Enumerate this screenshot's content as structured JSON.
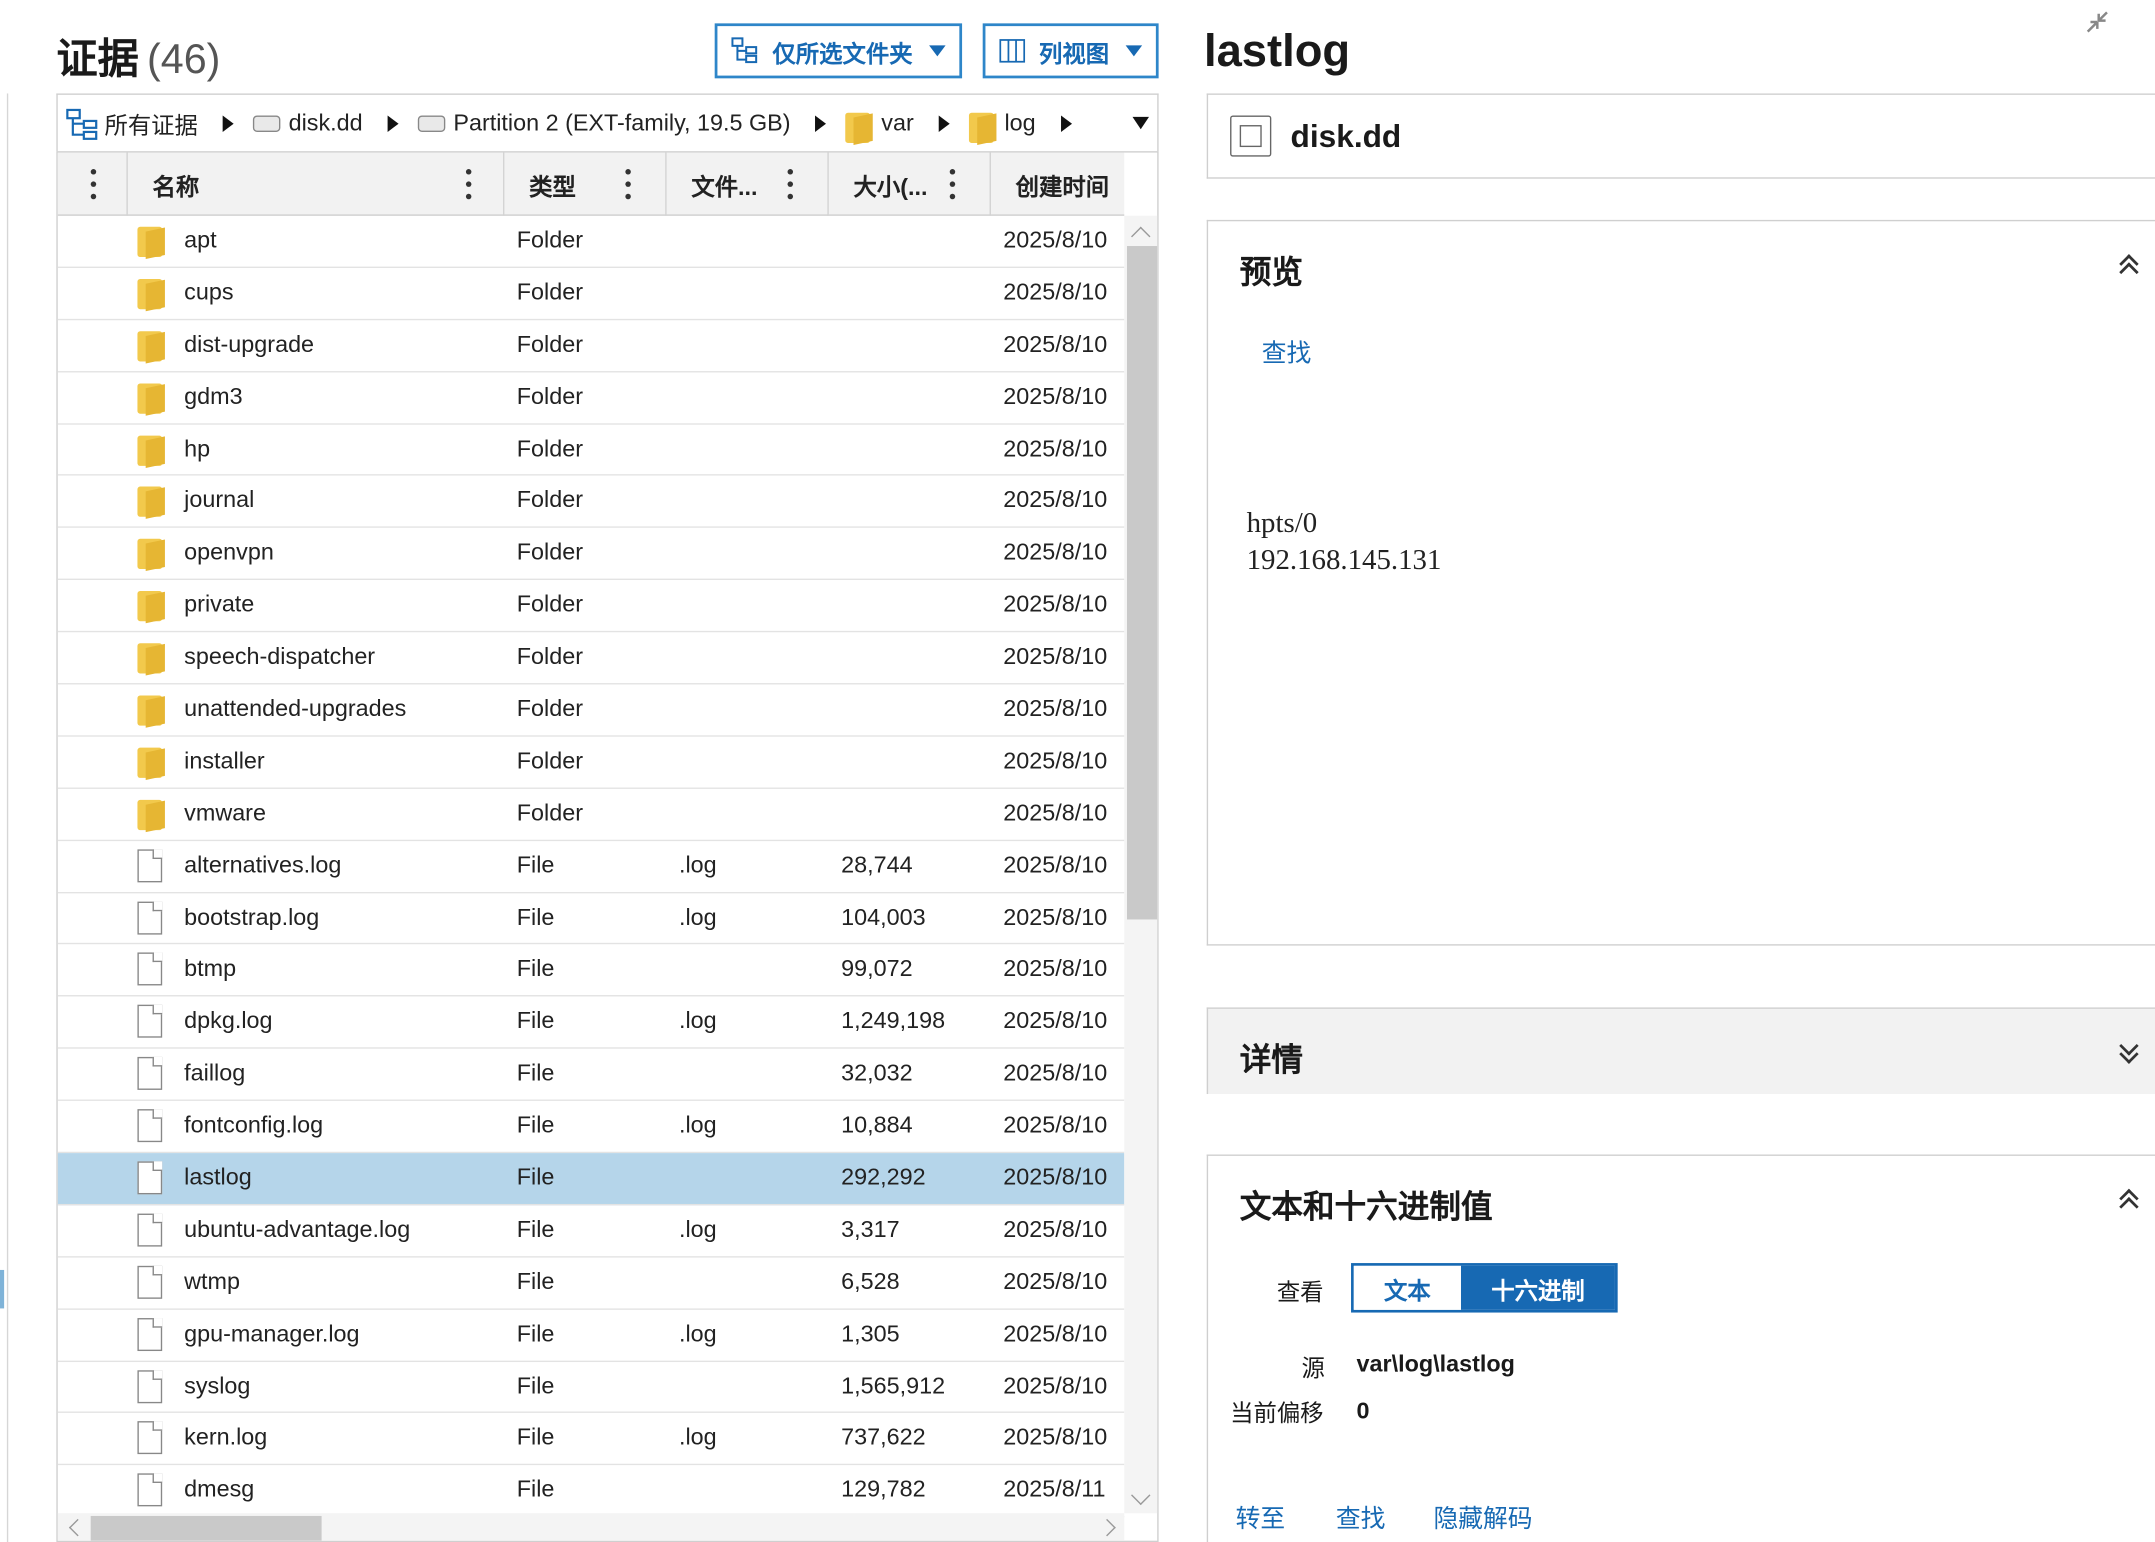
{
  "evidence": {
    "title": "证据",
    "count": "(46)"
  },
  "toolbar": {
    "folder_filter_label": "仅所选文件夹",
    "view_label": "列视图"
  },
  "breadcrumb": {
    "root": "所有证据",
    "disk": "disk.dd",
    "partition": "Partition 2 (EXT-family, 19.5 GB)",
    "var": "var",
    "log": "log"
  },
  "columns": {
    "name": "名称",
    "type": "类型",
    "ext": "文件...",
    "size": "大小(...",
    "created": "创建时间"
  },
  "rows": [
    {
      "icon": "folder-icon",
      "name": "apt",
      "type": "Folder",
      "ext": "",
      "size": "",
      "created": "2025/8/10"
    },
    {
      "icon": "folder-icon",
      "name": "cups",
      "type": "Folder",
      "ext": "",
      "size": "",
      "created": "2025/8/10"
    },
    {
      "icon": "folder-icon",
      "name": "dist-upgrade",
      "type": "Folder",
      "ext": "",
      "size": "",
      "created": "2025/8/10"
    },
    {
      "icon": "folder-icon",
      "name": "gdm3",
      "type": "Folder",
      "ext": "",
      "size": "",
      "created": "2025/8/10"
    },
    {
      "icon": "folder-icon",
      "name": "hp",
      "type": "Folder",
      "ext": "",
      "size": "",
      "created": "2025/8/10"
    },
    {
      "icon": "folder-icon",
      "name": "journal",
      "type": "Folder",
      "ext": "",
      "size": "",
      "created": "2025/8/10"
    },
    {
      "icon": "folder-icon",
      "name": "openvpn",
      "type": "Folder",
      "ext": "",
      "size": "",
      "created": "2025/8/10"
    },
    {
      "icon": "folder-icon",
      "name": "private",
      "type": "Folder",
      "ext": "",
      "size": "",
      "created": "2025/8/10"
    },
    {
      "icon": "folder-icon",
      "name": "speech-dispatcher",
      "type": "Folder",
      "ext": "",
      "size": "",
      "created": "2025/8/10"
    },
    {
      "icon": "folder-icon",
      "name": "unattended-upgrades",
      "type": "Folder",
      "ext": "",
      "size": "",
      "created": "2025/8/10"
    },
    {
      "icon": "folder-icon",
      "name": "installer",
      "type": "Folder",
      "ext": "",
      "size": "",
      "created": "2025/8/10"
    },
    {
      "icon": "folder-icon",
      "name": "vmware",
      "type": "Folder",
      "ext": "",
      "size": "",
      "created": "2025/8/10"
    },
    {
      "icon": "file-icon",
      "name": "alternatives.log",
      "type": "File",
      "ext": ".log",
      "size": "28,744",
      "created": "2025/8/10"
    },
    {
      "icon": "file-icon",
      "name": "bootstrap.log",
      "type": "File",
      "ext": ".log",
      "size": "104,003",
      "created": "2025/8/10"
    },
    {
      "icon": "file-icon",
      "name": "btmp",
      "type": "File",
      "ext": "",
      "size": "99,072",
      "created": "2025/8/10"
    },
    {
      "icon": "file-icon",
      "name": "dpkg.log",
      "type": "File",
      "ext": ".log",
      "size": "1,249,198",
      "created": "2025/8/10"
    },
    {
      "icon": "file-icon",
      "name": "faillog",
      "type": "File",
      "ext": "",
      "size": "32,032",
      "created": "2025/8/10"
    },
    {
      "icon": "file-icon",
      "name": "fontconfig.log",
      "type": "File",
      "ext": ".log",
      "size": "10,884",
      "created": "2025/8/10"
    },
    {
      "icon": "file-icon",
      "name": "lastlog",
      "type": "File",
      "ext": "",
      "size": "292,292",
      "created": "2025/8/10",
      "selected": true
    },
    {
      "icon": "file-icon",
      "name": "ubuntu-advantage.log",
      "type": "File",
      "ext": ".log",
      "size": "3,317",
      "created": "2025/8/10"
    },
    {
      "icon": "file-icon",
      "name": "wtmp",
      "type": "File",
      "ext": "",
      "size": "6,528",
      "created": "2025/8/10"
    },
    {
      "icon": "file-icon",
      "name": "gpu-manager.log",
      "type": "File",
      "ext": ".log",
      "size": "1,305",
      "created": "2025/8/10"
    },
    {
      "icon": "file-icon",
      "name": "syslog",
      "type": "File",
      "ext": "",
      "size": "1,565,912",
      "created": "2025/8/10"
    },
    {
      "icon": "file-icon",
      "name": "kern.log",
      "type": "File",
      "ext": ".log",
      "size": "737,622",
      "created": "2025/8/10"
    },
    {
      "icon": "file-icon",
      "name": "dmesg",
      "type": "File",
      "ext": "",
      "size": "129,782",
      "created": "2025/8/11"
    }
  ],
  "detail": {
    "title": "lastlog",
    "source_name": "disk.dd",
    "preview": {
      "title": "预览",
      "find_link": "查找",
      "lines": [
        "hpts/0",
        "192.168.145.131"
      ]
    },
    "details": {
      "title": "详情"
    },
    "texthex": {
      "title": "文本和十六进制值",
      "view_label": "查看",
      "text_tab": "文本",
      "hex_tab": "十六进制",
      "source_label": "源",
      "source_value": "var\\log\\lastlog",
      "offset_label": "当前偏移",
      "offset_value": "0",
      "goto_link": "转至",
      "find_link": "查找",
      "hide_decode_link": "隐藏解码"
    }
  },
  "colors": {
    "accent": "#1769b3",
    "selection": "#b5d5ea",
    "folder": "#f2c94c"
  }
}
